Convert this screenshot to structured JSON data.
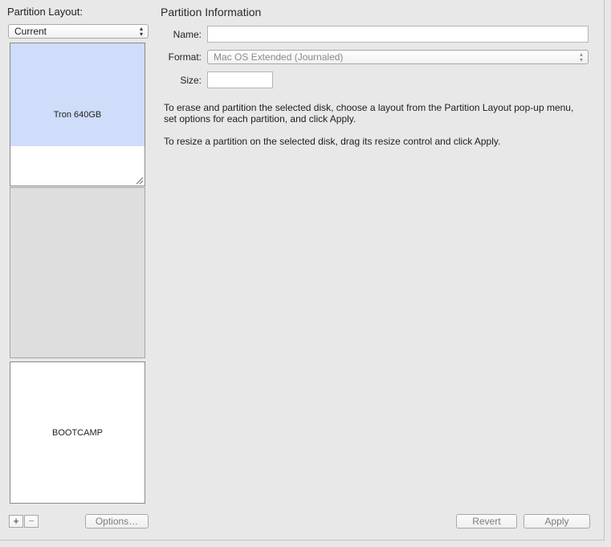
{
  "sidebar": {
    "title": "Partition Layout:",
    "layout_popup_value": "Current",
    "partitions": [
      {
        "label": "Tron 640GB",
        "selected": true
      },
      {
        "label": ""
      },
      {
        "label": "BOOTCAMP"
      }
    ],
    "add_label": "+",
    "remove_label": "−",
    "options_label": "Options…"
  },
  "info": {
    "title": "Partition Information",
    "name_label": "Name:",
    "name_value": "",
    "format_label": "Format:",
    "format_value": "Mac OS Extended (Journaled)",
    "size_label": "Size:",
    "size_value": "",
    "help_line1": "To erase and partition the selected disk, choose a layout from the Partition Layout pop-up menu,",
    "help_line2": "set options for each partition, and click Apply.",
    "help_line3": "To resize a partition on the selected disk, drag its resize control and click Apply."
  },
  "footer": {
    "revert_label": "Revert",
    "apply_label": "Apply"
  },
  "colors": {
    "selected_fill": "#cfdcfa",
    "free_space": "#dedede",
    "background": "#e8e8e8"
  }
}
